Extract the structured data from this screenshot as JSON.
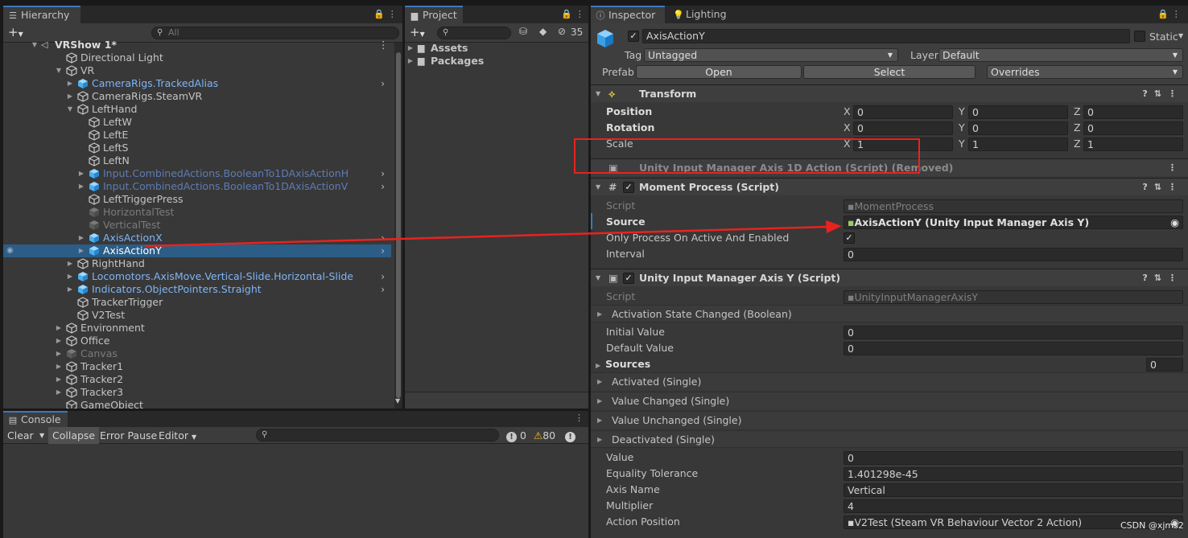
{
  "hierarchy": {
    "tab_label": "Hierarchy",
    "search_placeholder": "All",
    "scene_name": "VRShow 1*",
    "items": [
      {
        "label": "Directional Light"
      },
      {
        "label": "VR"
      },
      {
        "label": "CameraRigs.TrackedAlias"
      },
      {
        "label": "CameraRigs.SteamVR"
      },
      {
        "label": "LeftHand"
      },
      {
        "label": "LeftW"
      },
      {
        "label": "LeftE"
      },
      {
        "label": "LeftS"
      },
      {
        "label": "LeftN"
      },
      {
        "label": "Input.CombinedActions.BooleanTo1DAxisActionH"
      },
      {
        "label": "Input.CombinedActions.BooleanTo1DAxisActionV"
      },
      {
        "label": "LeftTriggerPress"
      },
      {
        "label": "HorizontalTest"
      },
      {
        "label": "VerticalTest"
      },
      {
        "label": "AxisActionX"
      },
      {
        "label": "AxisActionY"
      },
      {
        "label": "RightHand"
      },
      {
        "label": "Locomotors.AxisMove.Vertical-Slide.Horizontal-Slide"
      },
      {
        "label": "Indicators.ObjectPointers.Straight"
      },
      {
        "label": "TrackerTrigger"
      },
      {
        "label": "V2Test"
      },
      {
        "label": "Environment"
      },
      {
        "label": "Office"
      },
      {
        "label": "Canvas"
      },
      {
        "label": "Tracker1"
      },
      {
        "label": "Tracker2"
      },
      {
        "label": "Tracker3"
      },
      {
        "label": "GameObject"
      }
    ]
  },
  "project": {
    "tab_label": "Project",
    "hidden_count": "35",
    "folders": [
      "Assets",
      "Packages"
    ]
  },
  "console": {
    "tab_label": "Console",
    "clear": "Clear",
    "collapse": "Collapse",
    "error_pause": "Error Pause",
    "editor": "Editor",
    "count_info": "0",
    "count_warn": "80",
    "count_error": "0"
  },
  "inspector": {
    "tab_label": "Inspector",
    "lighting_tab": "Lighting",
    "object_name": "AxisActionY",
    "static_label": "Static",
    "tag_label": "Tag",
    "tag_value": "Untagged",
    "layer_label": "Layer",
    "layer_value": "Default",
    "prefab_label": "Prefab",
    "open_btn": "Open",
    "select_btn": "Select",
    "overrides": "Overrides",
    "transform": {
      "title": "Transform",
      "position": "Position",
      "rotation": "Rotation",
      "scale": "Scale",
      "x": "X",
      "y": "Y",
      "z": "Z",
      "pos": [
        "0",
        "0",
        "0"
      ],
      "rot": [
        "0",
        "0",
        "0"
      ],
      "scl": [
        "1",
        "1",
        "1"
      ]
    },
    "removed_component": "Unity Input Manager Axis 1D Action (Script) (Removed)",
    "moment": {
      "title": "Moment Process (Script)",
      "script_label": "Script",
      "script_value": "MomentProcess",
      "source_label": "Source",
      "source_value": "AxisActionY (Unity Input Manager Axis Y)",
      "only_process_label": "Only Process On Active And Enabled",
      "interval_label": "Interval",
      "interval_value": "0"
    },
    "axisy": {
      "title": "Unity Input Manager Axis Y (Script)",
      "script_label": "Script",
      "script_value": "UnityInputManagerAxisY",
      "activation_state": "Activation State Changed (Boolean)",
      "initial_label": "Initial Value",
      "initial_value": "0",
      "default_label": "Default Value",
      "default_value": "0",
      "sources_label": "Sources",
      "sources_value": "0",
      "activated": "Activated (Single)",
      "value_changed": "Value Changed (Single)",
      "value_unchanged": "Value Unchanged (Single)",
      "deactivated": "Deactivated (Single)",
      "value_label": "Value",
      "value_value": "0",
      "equality_label": "Equality Tolerance",
      "equality_value": "1.401298e-45",
      "axis_name_label": "Axis Name",
      "axis_name_value": "Vertical",
      "multiplier_label": "Multiplier",
      "multiplier_value": "4",
      "action_position_label": "Action Position",
      "action_position_value": "V2Test (Steam VR Behaviour Vector 2 Action)"
    }
  },
  "watermark": "CSDN @xjms2",
  "colors": {
    "selection": "#2c5d87",
    "prefab_blue": "#7fb4f5",
    "annotation_red": "#e8231f"
  }
}
